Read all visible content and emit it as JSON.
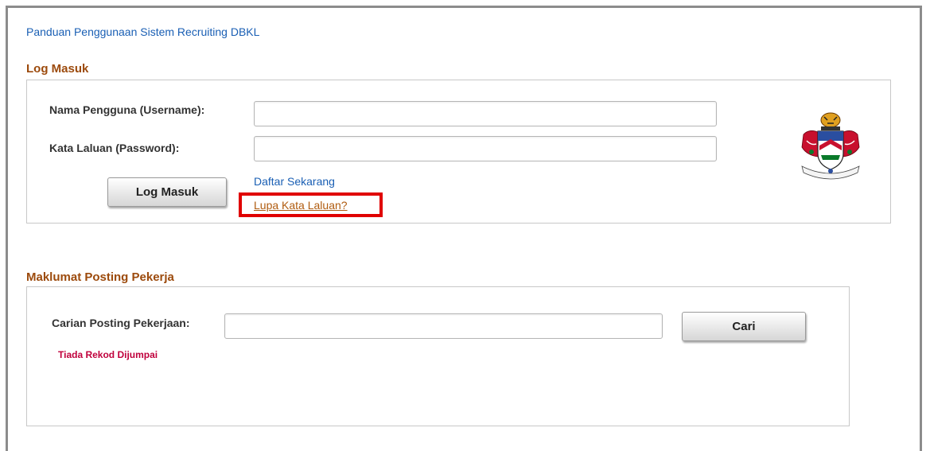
{
  "guide_link": "Panduan Penggunaan Sistem Recruiting DBKL",
  "login": {
    "section_title": "Log Masuk",
    "username_label": "Nama Pengguna (Username):",
    "username_value": "",
    "password_label": "Kata Laluan (Password):",
    "password_value": "",
    "login_button": "Log Masuk",
    "register_link": "Daftar Sekarang",
    "forgot_link": "Lupa Kata Laluan?"
  },
  "jobs": {
    "section_title": "Maklumat Posting Pekerja",
    "search_label": "Carian Posting Pekerjaan:",
    "search_value": "",
    "search_button": "Cari",
    "no_records": "Tiada Rekod Dijumpai"
  },
  "colors": {
    "section_title": "#9c4a0c",
    "link": "#1a5fb4",
    "highlight": "#e00000",
    "no_records": "#c0003c"
  },
  "icons": {
    "crest": "dbkl-crest-icon"
  }
}
